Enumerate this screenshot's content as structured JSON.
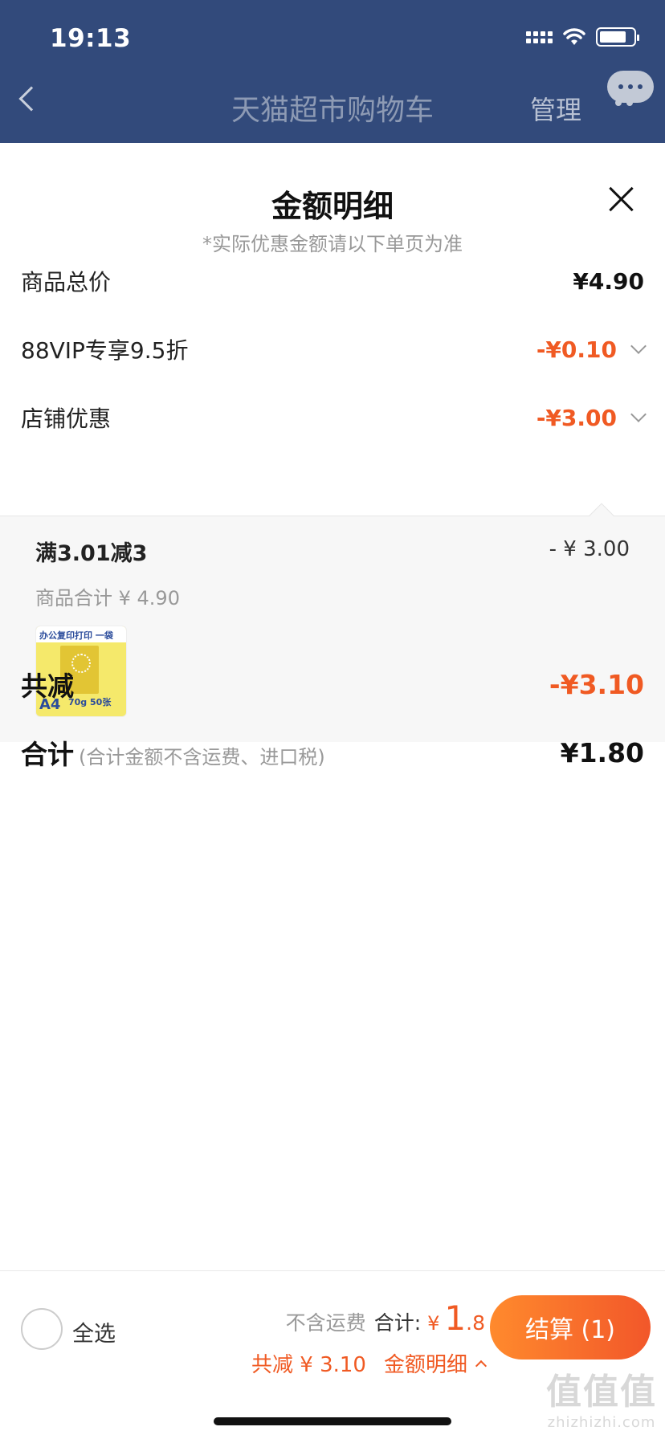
{
  "status_bar": {
    "time": "19:13"
  },
  "nav": {
    "title": "天猫超市购物车",
    "manage": "管理"
  },
  "sheet": {
    "title": "金额明细",
    "subtitle": "*实际优惠金额请以下单页为准",
    "rows": [
      {
        "label": "商品总价",
        "value": "¥4.90"
      },
      {
        "label": "88VIP专享9.5折",
        "value": "-¥0.10"
      },
      {
        "label": "店铺优惠",
        "value": "-¥3.00"
      }
    ],
    "store_discount_detail": {
      "name": "满3.01减3",
      "amount": "- ¥ 3.00",
      "subtotal": "商品合计 ¥ 4.90",
      "thumb": {
        "banner": "办公复印打印 一袋",
        "size": "A4",
        "spec": "70g 50张"
      }
    },
    "total_reduction": {
      "label": "共减",
      "value": "-¥3.10"
    },
    "grand_total": {
      "label": "合计",
      "note": "(合计金额不含运费、进口税)",
      "value": "¥1.80"
    }
  },
  "bottom_bar": {
    "select_all": "全选",
    "shipping_note": "不含运费",
    "total_label": "合计:",
    "currency": "¥",
    "total_int": "1",
    "total_dec": ".8",
    "saved": "共减 ¥ 3.10",
    "detail_link": "金额明细",
    "checkout": "结算 (1)"
  },
  "watermark": {
    "main": "值值值",
    "sub": "zhizhizhi.com"
  },
  "colors": {
    "accent": "#f05a23",
    "nav_bg": "#324a7b"
  }
}
